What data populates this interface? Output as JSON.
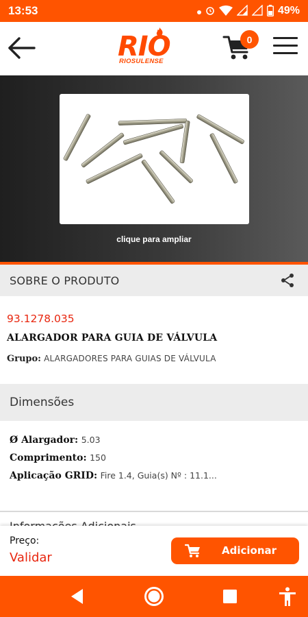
{
  "status_bar": {
    "time": "13:53",
    "battery": "49%",
    "icons": [
      "notification-dot-icon",
      "alarm-icon",
      "wifi-icon",
      "signal-4g-icon",
      "signal-icon",
      "battery-icon"
    ]
  },
  "header": {
    "logo_text": "RIO",
    "logo_subtext": "RIOSULENSE",
    "cart_count": "0",
    "icons": {
      "back": "arrow-left-icon",
      "cart": "cart-icon",
      "menu": "hamburger-menu-icon"
    }
  },
  "gallery": {
    "zoom_hint": "clique para ampliar",
    "image_alt": "product-photo"
  },
  "about": {
    "title": "SOBRE O PRODUTO",
    "share_icon": "share-icon"
  },
  "product": {
    "code": "93.1278.035",
    "name": "ALARGADOR PARA GUIA DE VÁLVULA",
    "group_label": "Grupo:",
    "group_value": "ALARGADORES PARA GUIAS DE VÁLVULA"
  },
  "dimensions": {
    "title": "Dimensões",
    "rows": [
      {
        "label": "Ø Alargador:",
        "value": "5.03"
      },
      {
        "label": "Comprimento:",
        "value": "150"
      },
      {
        "label": "Aplicação GRID:",
        "value": "Fire 1.4, Guia(s) Nº : 11.1..."
      }
    ]
  },
  "additional_info": {
    "title": "Informações Adicionais"
  },
  "purchase": {
    "price_label": "Preço:",
    "price_value": "Validar",
    "add_label": "Adicionar"
  },
  "colors": {
    "brand_orange": "#ff5400",
    "code_red": "#e8260f",
    "section_gray": "#ececec"
  },
  "nav_bar": {
    "icons": [
      "back-triangle-icon",
      "home-circle-icon",
      "recents-square-icon",
      "accessibility-icon"
    ]
  }
}
